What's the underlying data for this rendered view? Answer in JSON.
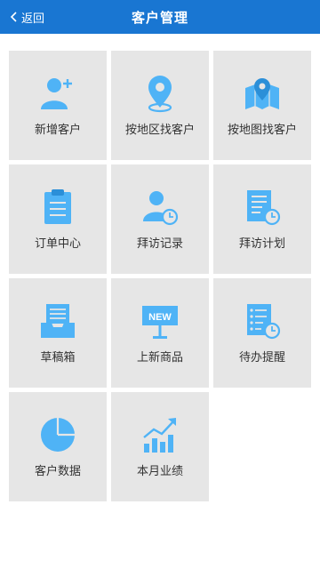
{
  "header": {
    "back_label": "返回",
    "title": "客户管理",
    "bg_color": "#1976d2"
  },
  "menu": {
    "accent_color": "#4fb3f6",
    "tile_color": "#e6e6e6",
    "items": [
      {
        "label": "新增客户",
        "icon": "add-user-icon"
      },
      {
        "label": "按地区找客户",
        "icon": "location-pin-icon"
      },
      {
        "label": "按地图找客户",
        "icon": "map-pin-icon"
      },
      {
        "label": "订单中心",
        "icon": "clipboard-icon"
      },
      {
        "label": "拜访记录",
        "icon": "user-clock-icon"
      },
      {
        "label": "拜访计划",
        "icon": "document-clock-icon"
      },
      {
        "label": "草稿箱",
        "icon": "inbox-tray-icon"
      },
      {
        "label": "上新商品",
        "icon": "new-sign-icon"
      },
      {
        "label": "待办提醒",
        "icon": "list-clock-icon"
      },
      {
        "label": "客户数据",
        "icon": "pie-chart-icon"
      },
      {
        "label": "本月业绩",
        "icon": "growth-chart-icon"
      }
    ]
  }
}
